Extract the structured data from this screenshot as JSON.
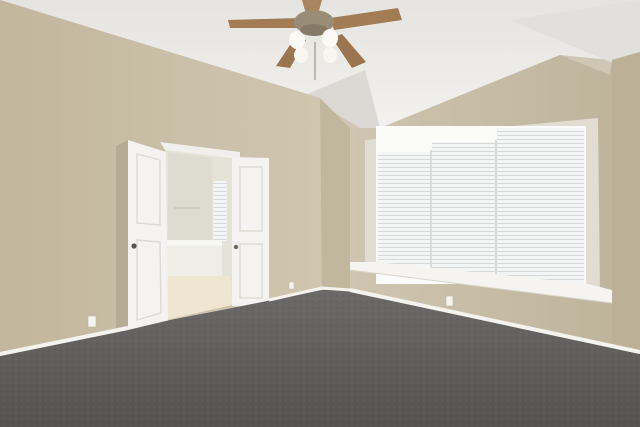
{
  "scene": {
    "subject": "empty-bedroom",
    "objects": [
      "ceiling-fan",
      "double-door",
      "bathtub",
      "window-blinds",
      "carpet-floor",
      "outlet"
    ],
    "colors": {
      "wall_left": "#cabfa8",
      "wall_back": "#c8bea7",
      "wall_right": "#c4b9a2",
      "ceiling": "#ebe9e6",
      "ceiling_shadow": "#dad7d2",
      "carpet": "#5f5d5c",
      "carpet_far": "#6c6a69",
      "trim": "#f3f1ec",
      "door": "#f4f3f1",
      "blinds": "#f1f2f2",
      "fan_wood": "#a17c55",
      "fan_metal": "#9a8d78",
      "bath_wall": "#e2e1d6",
      "bath_floor": "#efe7d4"
    }
  }
}
